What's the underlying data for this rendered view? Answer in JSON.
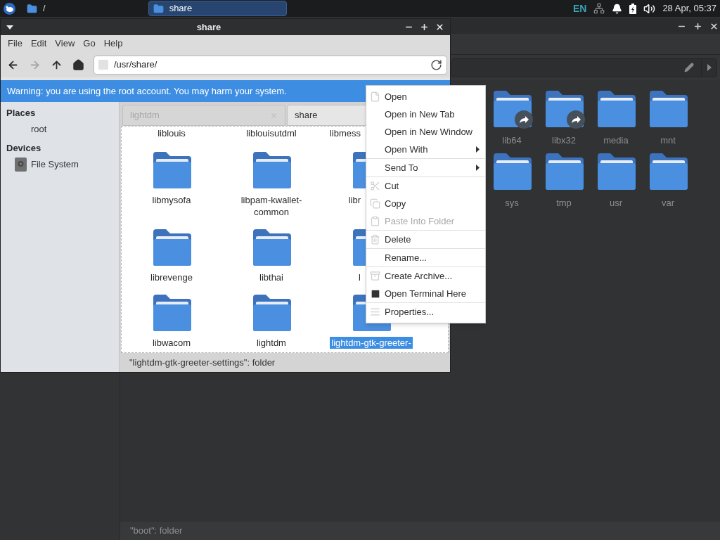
{
  "taskbar": {
    "tasks": [
      {
        "label": "/",
        "selected": false
      },
      {
        "label": "share",
        "selected": true
      }
    ],
    "language": "EN",
    "clock": "28 Apr, 05:37"
  },
  "back_window": {
    "items": [
      {
        "name": "lib64",
        "link": true
      },
      {
        "name": "libx32",
        "link": true
      },
      {
        "name": "media",
        "link": false
      },
      {
        "name": "mnt",
        "link": false
      },
      {
        "name": "sys",
        "link": false
      },
      {
        "name": "tmp",
        "link": false
      },
      {
        "name": "usr",
        "link": false
      },
      {
        "name": "var",
        "link": false
      }
    ],
    "status_bar": "\"boot\": folder"
  },
  "window": {
    "title": "share",
    "menu": [
      "File",
      "Edit",
      "View",
      "Go",
      "Help"
    ],
    "nav": [
      {
        "kind": "back",
        "disabled": false
      },
      {
        "kind": "forward",
        "disabled": true
      },
      {
        "kind": "up",
        "disabled": false
      },
      {
        "kind": "home",
        "disabled": false
      }
    ],
    "location": "/usr/share/",
    "warning": "Warning: you are using the root account. You may harm your system.",
    "sidebar": [
      {
        "heading": "Places",
        "items": [
          {
            "label": "root",
            "kind": "plain"
          }
        ]
      },
      {
        "heading": "Devices",
        "items": [
          {
            "label": "File System",
            "kind": "drive"
          }
        ]
      }
    ],
    "tabs": [
      {
        "label": "lightdm",
        "selected": false
      },
      {
        "label": "share",
        "selected": true
      }
    ],
    "items": [
      {
        "name": "liblouis",
        "kind": "label",
        "selected": false
      },
      {
        "name": "liblouisutdml",
        "kind": "label",
        "selected": false
      },
      {
        "name": "libmess",
        "kind": "label-cut",
        "selected": false
      },
      {
        "name": "libmysofa",
        "kind": "folder",
        "selected": false
      },
      {
        "name": "libpam-kwallet-common",
        "kind": "folder",
        "selected": false
      },
      {
        "name": "libr",
        "kind": "folder-cut",
        "selected": false
      },
      {
        "name": "librevenge",
        "kind": "folder",
        "selected": false
      },
      {
        "name": "libthai",
        "kind": "folder",
        "selected": false
      },
      {
        "name": "l",
        "kind": "folder-cut",
        "selected": false
      },
      {
        "name": "libwacom",
        "kind": "folder",
        "selected": false
      },
      {
        "name": "lightdm",
        "kind": "folder",
        "selected": false
      },
      {
        "name": "lightdm-gtk-greeter-",
        "kind": "folder",
        "selected": true
      }
    ],
    "status_bar": "\"lightdm-gtk-greeter-settings\": folder"
  },
  "context_menu": [
    [
      {
        "label": "Open",
        "submenu": false,
        "disabled": false
      },
      {
        "label": "Open in New Tab",
        "submenu": false,
        "disabled": false
      },
      {
        "label": "Open in New Window",
        "submenu": false,
        "disabled": false
      },
      {
        "label": "Open With",
        "submenu": true,
        "disabled": false
      }
    ],
    [
      {
        "label": "Send To",
        "submenu": true,
        "disabled": false
      }
    ],
    [
      {
        "label": "Cut",
        "submenu": false,
        "disabled": false
      },
      {
        "label": "Copy",
        "submenu": false,
        "disabled": false
      },
      {
        "label": "Paste Into Folder",
        "submenu": false,
        "disabled": true
      }
    ],
    [
      {
        "label": "Delete",
        "submenu": false,
        "disabled": false
      }
    ],
    [
      {
        "label": "Rename...",
        "submenu": false,
        "disabled": false
      }
    ],
    [
      {
        "label": "Create Archive...",
        "submenu": false,
        "disabled": false
      },
      {
        "label": "Open Terminal Here",
        "submenu": false,
        "disabled": false
      }
    ],
    [
      {
        "label": "Properties...",
        "submenu": false,
        "disabled": false
      }
    ]
  ]
}
